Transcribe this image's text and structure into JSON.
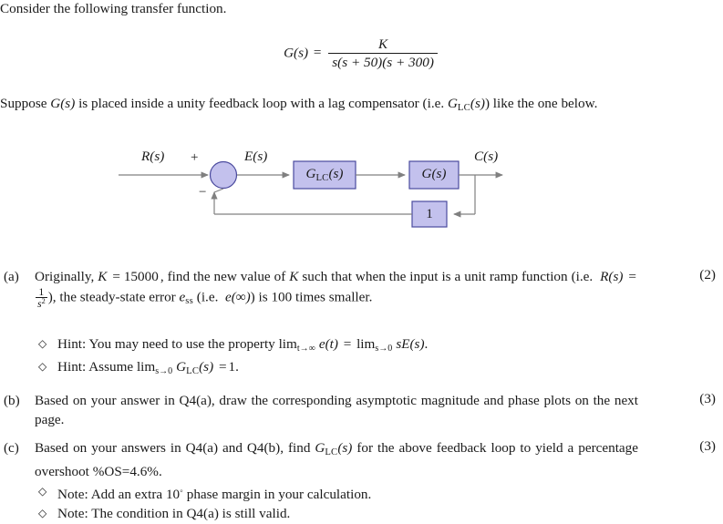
{
  "document": {
    "intro": "Consider the following transfer function.",
    "equation": {
      "lhs": "G(s)",
      "relation": "=",
      "numerator": "K",
      "denominator": "s(s + 50)(s + 300)"
    },
    "suppose_paragraph": {
      "part1": "Suppose ",
      "gs": "G(s)",
      "part2": " is placed inside a unity feedback loop with a lag compensator (i.e. ",
      "glc": "G",
      "glc_sub": "LC",
      "glc_arg": "(s)",
      "part3": ") like the one below."
    }
  },
  "diagram": {
    "name": "unity-feedback-loop-block-diagram",
    "input_label": "R(s)",
    "plus_sign": "+",
    "minus_sign": "−",
    "error_label": "E(s)",
    "compensator_label": "G",
    "compensator_sub": "LC",
    "compensator_arg": "(s)",
    "plant_label": "G(s)",
    "feedback_label": "1",
    "output_label": "C(s)",
    "colors": {
      "block_fill": "#c3c1ed",
      "block_stroke": "#4a4a9e",
      "line": "#808080",
      "text": "#141414"
    }
  },
  "questions": [
    {
      "marker": "(a)",
      "marks": "(2)",
      "text_before_K": "Originally, ",
      "K": "K",
      "eq": "= 15000",
      "text_mid": ", find the new value of ",
      "K2": "K",
      "text_mid2": " such that when the input is a unit ramp function (i.e. ",
      "Rs": "R(s)",
      "rel": "=",
      "frac_num": "1",
      "frac_den": "s",
      "frac_den_sup": "2",
      "text_mid3": "), the steady-state error ",
      "ess": "e",
      "ess_sub": "ss",
      "text_mid4": " (i.e. ",
      "einf": "e(∞)",
      "text_end": ") is 100 times smaller.",
      "subitems": [
        {
          "bullet": "◇",
          "label": "Hint:",
          "text": " You may need to use the property ",
          "lim1": "lim",
          "lim1_sub": "t→∞",
          "expr1": "e(t)",
          "rel": "=",
          "lim2": "lim",
          "lim2_sub": "s→0",
          "expr2": "sE(s)",
          "tail": "."
        },
        {
          "bullet": "◇",
          "label": "Hint:",
          "text": " Assume ",
          "lim1": "lim",
          "lim1_sub": "s→0",
          "expr1": "G",
          "expr1_sub": "LC",
          "expr1_arg": "(s)",
          "rel": "=",
          "value": "1",
          "tail": "."
        }
      ]
    },
    {
      "marker": "(b)",
      "marks": "(3)",
      "text": "Based on your answer in Q4(a), draw the corresponding asymptotic magnitude and phase plots on the next page.",
      "subitems": []
    },
    {
      "marker": "(c)",
      "marks": "(3)",
      "text_before": "Based on your answers in Q4(a) and Q4(b), find ",
      "glc": "G",
      "glc_sub": "LC",
      "glc_arg": "(s)",
      "text_after": " for the above feedback loop to yield a percentage overshoot %OS=4.6%.",
      "subitems": [
        {
          "bullet": "◇",
          "label": "Note:",
          "text": " Add an extra 10",
          "degree": "◦",
          "text2": " phase margin in your calculation."
        },
        {
          "bullet": "◇",
          "label": "Note:",
          "text": " The condition in Q4(a) is still valid."
        }
      ]
    }
  ]
}
